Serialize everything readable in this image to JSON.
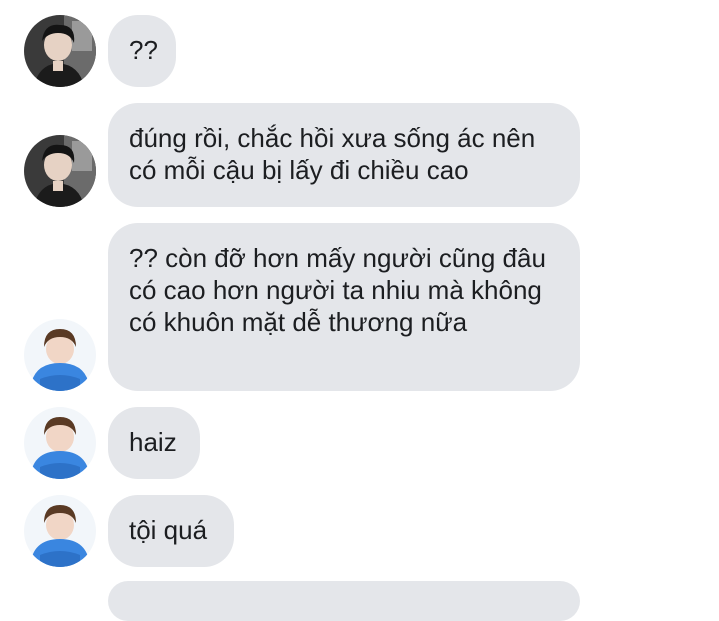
{
  "messages": [
    {
      "sender": "friend-dark",
      "text": "??"
    },
    {
      "sender": "friend-dark",
      "text": "đúng rồi, chắc hồi xưa sống ác nên có mỗi cậu bị lấy đi chiều cao"
    },
    {
      "sender": "friend-blue",
      "text": "?? còn đỡ hơn mấy người cũng đâu có cao hơn người ta nhiu mà không có khuôn mặt dễ thương nữa"
    },
    {
      "sender": "friend-blue",
      "text": "haiz"
    },
    {
      "sender": "friend-blue",
      "text": "tội quá"
    }
  ]
}
